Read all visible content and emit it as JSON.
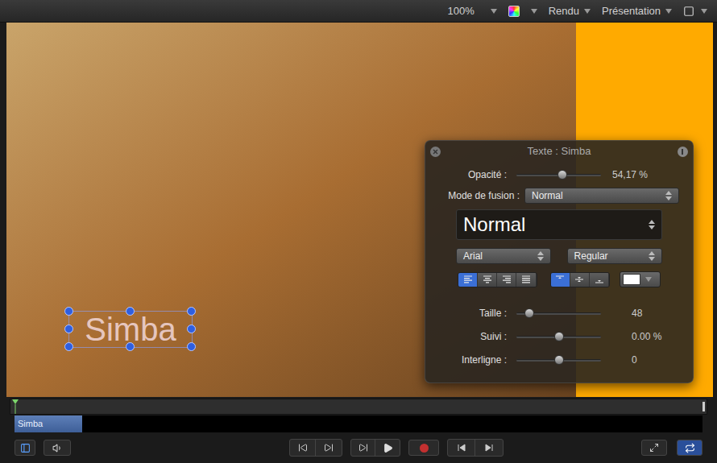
{
  "toolbar": {
    "zoom": "100%",
    "render": "Rendu",
    "view": "Présentation"
  },
  "canvas": {
    "text_object": {
      "label": "Simba",
      "selected": true
    }
  },
  "hud": {
    "title": "Texte : Simba",
    "opacity": {
      "label": "Opacité :",
      "level": 0.54,
      "reading": "54,17 %"
    },
    "blend": {
      "label": "Mode de fusion :",
      "value": "Normal"
    },
    "preset": "Normal",
    "font": "Arial",
    "style": "Regular",
    "alignment": [
      {
        "kind": "left",
        "selected": true
      },
      {
        "kind": "center",
        "selected": false
      },
      {
        "kind": "right",
        "selected": false
      },
      {
        "kind": "justify",
        "selected": false
      }
    ],
    "vertical_alignment": [
      {
        "kind": "top",
        "selected": true
      },
      {
        "kind": "middle",
        "selected": false
      },
      {
        "kind": "bottom",
        "selected": false
      }
    ],
    "color_well": {
      "color": "#ffffff"
    },
    "sliders": [
      {
        "label": "Taille :",
        "level": 0.15,
        "reading": "48"
      },
      {
        "label": "Suivi :",
        "level": 0.5,
        "reading": "0.00 %"
      },
      {
        "label": "Interligne :",
        "level": 0.5,
        "reading": "0"
      }
    ]
  },
  "timeline": {
    "clips": [
      {
        "label": "Simba",
        "selected": true
      }
    ]
  },
  "transport": {
    "recording": false,
    "loop": true
  }
}
